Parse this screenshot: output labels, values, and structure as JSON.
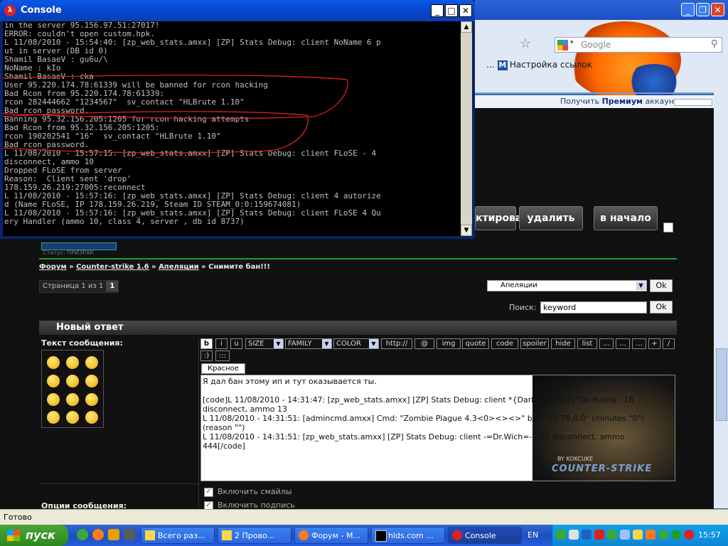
{
  "console": {
    "title": "Console",
    "lines": [
      "in the server 95.156.97.51:27017!",
      "ERROR: couldn't open custom.hpk.",
      "L 11/08/2010 - 15:54:40: [zp_web_stats.amxx] [ZP] Stats Debug: client NoName 6 p",
      "ut in server (DB id 0)",
      "Shamil BasaeV : gu6u/\\",
      "NoName : kIo",
      "Shamil BasaeV : cka",
      "User 95.220.174.78:61339 will be banned for rcon hacking",
      "Bad Rcon from 95.220.174.78:61339:",
      "rcon 282444662 \"1234567\"  sv_contact \"HLBrute 1.10\"",
      "Bad rcon_password.",
      "Banning 95.32.156.205:1205 for rcon hacking attempts",
      "Bad Rcon from 95.32.156.205:1205:",
      "rcon 190202541 \"16\"  sv_contact \"HLBrute 1.10\"",
      "Bad rcon_password.",
      "L 11/08/2010 - 15:57:15: [zp_web_stats.amxx] [ZP] Stats Debug: client FLoSE - 4",
      "disconnect, ammo 10",
      "Dropped FLoSE from server",
      "Reason:  Client sent 'drop'",
      "178.159.26.219:27005:reconnect",
      "L 11/08/2010 - 15:57:16: [zp_web_stats.amxx] [ZP] Stats Debug: client 4 autorize",
      "d (Name FLoSE, IP 178.159.26.219, Steam ID STEAM_0:0:159674081)",
      "L 11/08/2010 - 15:57:16: [zp_web_stats.amxx] [ZP] Stats Debug: client FLoSE 4 Qu",
      "ery Handler (ammo 10, class 4, server , db id 8737)"
    ],
    "btn_min": "_",
    "btn_max": "□",
    "btn_close": "✕"
  },
  "firefox": {
    "search_placeholder": "Google",
    "bookmark": "Настройка ссылок",
    "bookmark_prefix": "…",
    "premium_text": "Получить",
    "premium_bold": "Премиум",
    "premium_suffix": "аккаунт"
  },
  "forum": {
    "buttons": [
      "ктировать",
      "удалить",
      "в начало"
    ],
    "status_mini": "Статус: ПРИЗРАК",
    "breadcrumb": [
      "Форум",
      "Counter-strike 1.6",
      "Апеляции",
      "Снимите бан!!!"
    ],
    "breadcrumb_sep": "»",
    "pager_label": "Страница 1 из 1",
    "pager_num": "1",
    "select_value": "Апеляции",
    "ok": "Ok",
    "search_label": "Поиск:",
    "search_value": "keyword",
    "reply_header": "Новый ответ",
    "message_label": "Текст сообщения:",
    "options_label": "Опции сообщения:",
    "toolbar": {
      "b": "b",
      "i": "i",
      "u": "u",
      "size": "SIZE",
      "family": "FAMILY",
      "color": "COLOR",
      "http": "http://",
      "at": "@",
      "img": "img",
      "quote": "quote",
      "code": "code",
      "spoiler": "spoiler",
      "hide": "hide",
      "list": "list",
      "e1": "...",
      "e2": "...",
      "e3": "...",
      "plus": "+",
      "slash": "/",
      "smile": ":)",
      "more": ":::"
    },
    "red_button": "Красное",
    "editor_text": "Я дал бан этому ип и тут оказывается ты.\n\n[code]L 11/08/2010 - 14:31:47: [zp_web_stats.amxx] [ZP] Stats Debug: client *{Dark Vampire}*Tal.Rusha - 18\ndisconnect, ammo 13\nL 11/08/2010 - 14:31:51: [admincmd.amxx] Cmd: \"Zombie Plague 4.3<0><><>\" ban \"95.79.0.0\" (minutes \"0\")\n(reason \"\")\nL 11/08/2010 - 14:31:51: [zp_web_stats.amxx] [ZP] Stats Debug: client -=Dr.Wich=- - 20 disconnect, ammo\n444[/code]",
    "cs_by": "BY KOKCUKE",
    "cs_logo": "COUNTER-STRIKE",
    "opt_smilies": "Включить смайлы",
    "opt_signature": "Включить подпись"
  },
  "statusbar": "Готово",
  "taskbar": {
    "start": "пуск",
    "tasks": [
      "Всего раз...",
      "2 Прово...",
      "Форум - М...",
      "hlds.com ...",
      "Console"
    ],
    "lang": "EN",
    "clock": "15:57"
  },
  "colors": {
    "accent": "#1aa02a",
    "taskbar": "#245ddb",
    "console_bg": "#000000",
    "console_fg": "#c0c0c0",
    "annotation": "#e02020"
  }
}
